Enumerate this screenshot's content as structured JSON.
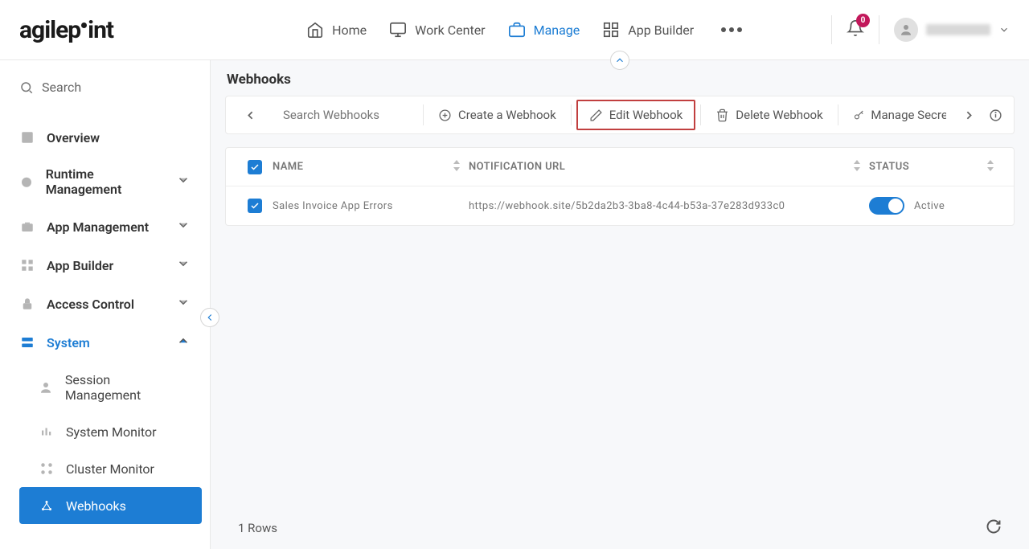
{
  "header": {
    "logo_text": "agilepoint",
    "nav": {
      "home": "Home",
      "work_center": "Work Center",
      "manage": "Manage",
      "app_builder": "App Builder"
    },
    "notifications_count": "0"
  },
  "sidebar": {
    "search_placeholder": "Search",
    "items": {
      "overview": "Overview",
      "runtime": "Runtime Management",
      "app_management": "App Management",
      "app_builder": "App Builder",
      "access_control": "Access Control",
      "system": "System"
    },
    "system_sub": {
      "session": "Session Management",
      "sysmon": "System Monitor",
      "cluster": "Cluster Monitor",
      "webhooks": "Webhooks"
    }
  },
  "main": {
    "title": "Webhooks",
    "toolbar": {
      "search_placeholder": "Search Webhooks",
      "create": "Create a Webhook",
      "edit": "Edit Webhook",
      "delete": "Delete Webhook",
      "secrets": "Manage Secrets"
    },
    "columns": {
      "name": "Name",
      "url": "Notification URL",
      "status": "Status"
    },
    "rows": [
      {
        "name": "Sales Invoice App Errors",
        "url": "https://webhook.site/5b2da2b3-3ba8-4c44-b53a-37e283d933c0",
        "status_label": "Active"
      }
    ],
    "footer_rows": "1 Rows"
  }
}
